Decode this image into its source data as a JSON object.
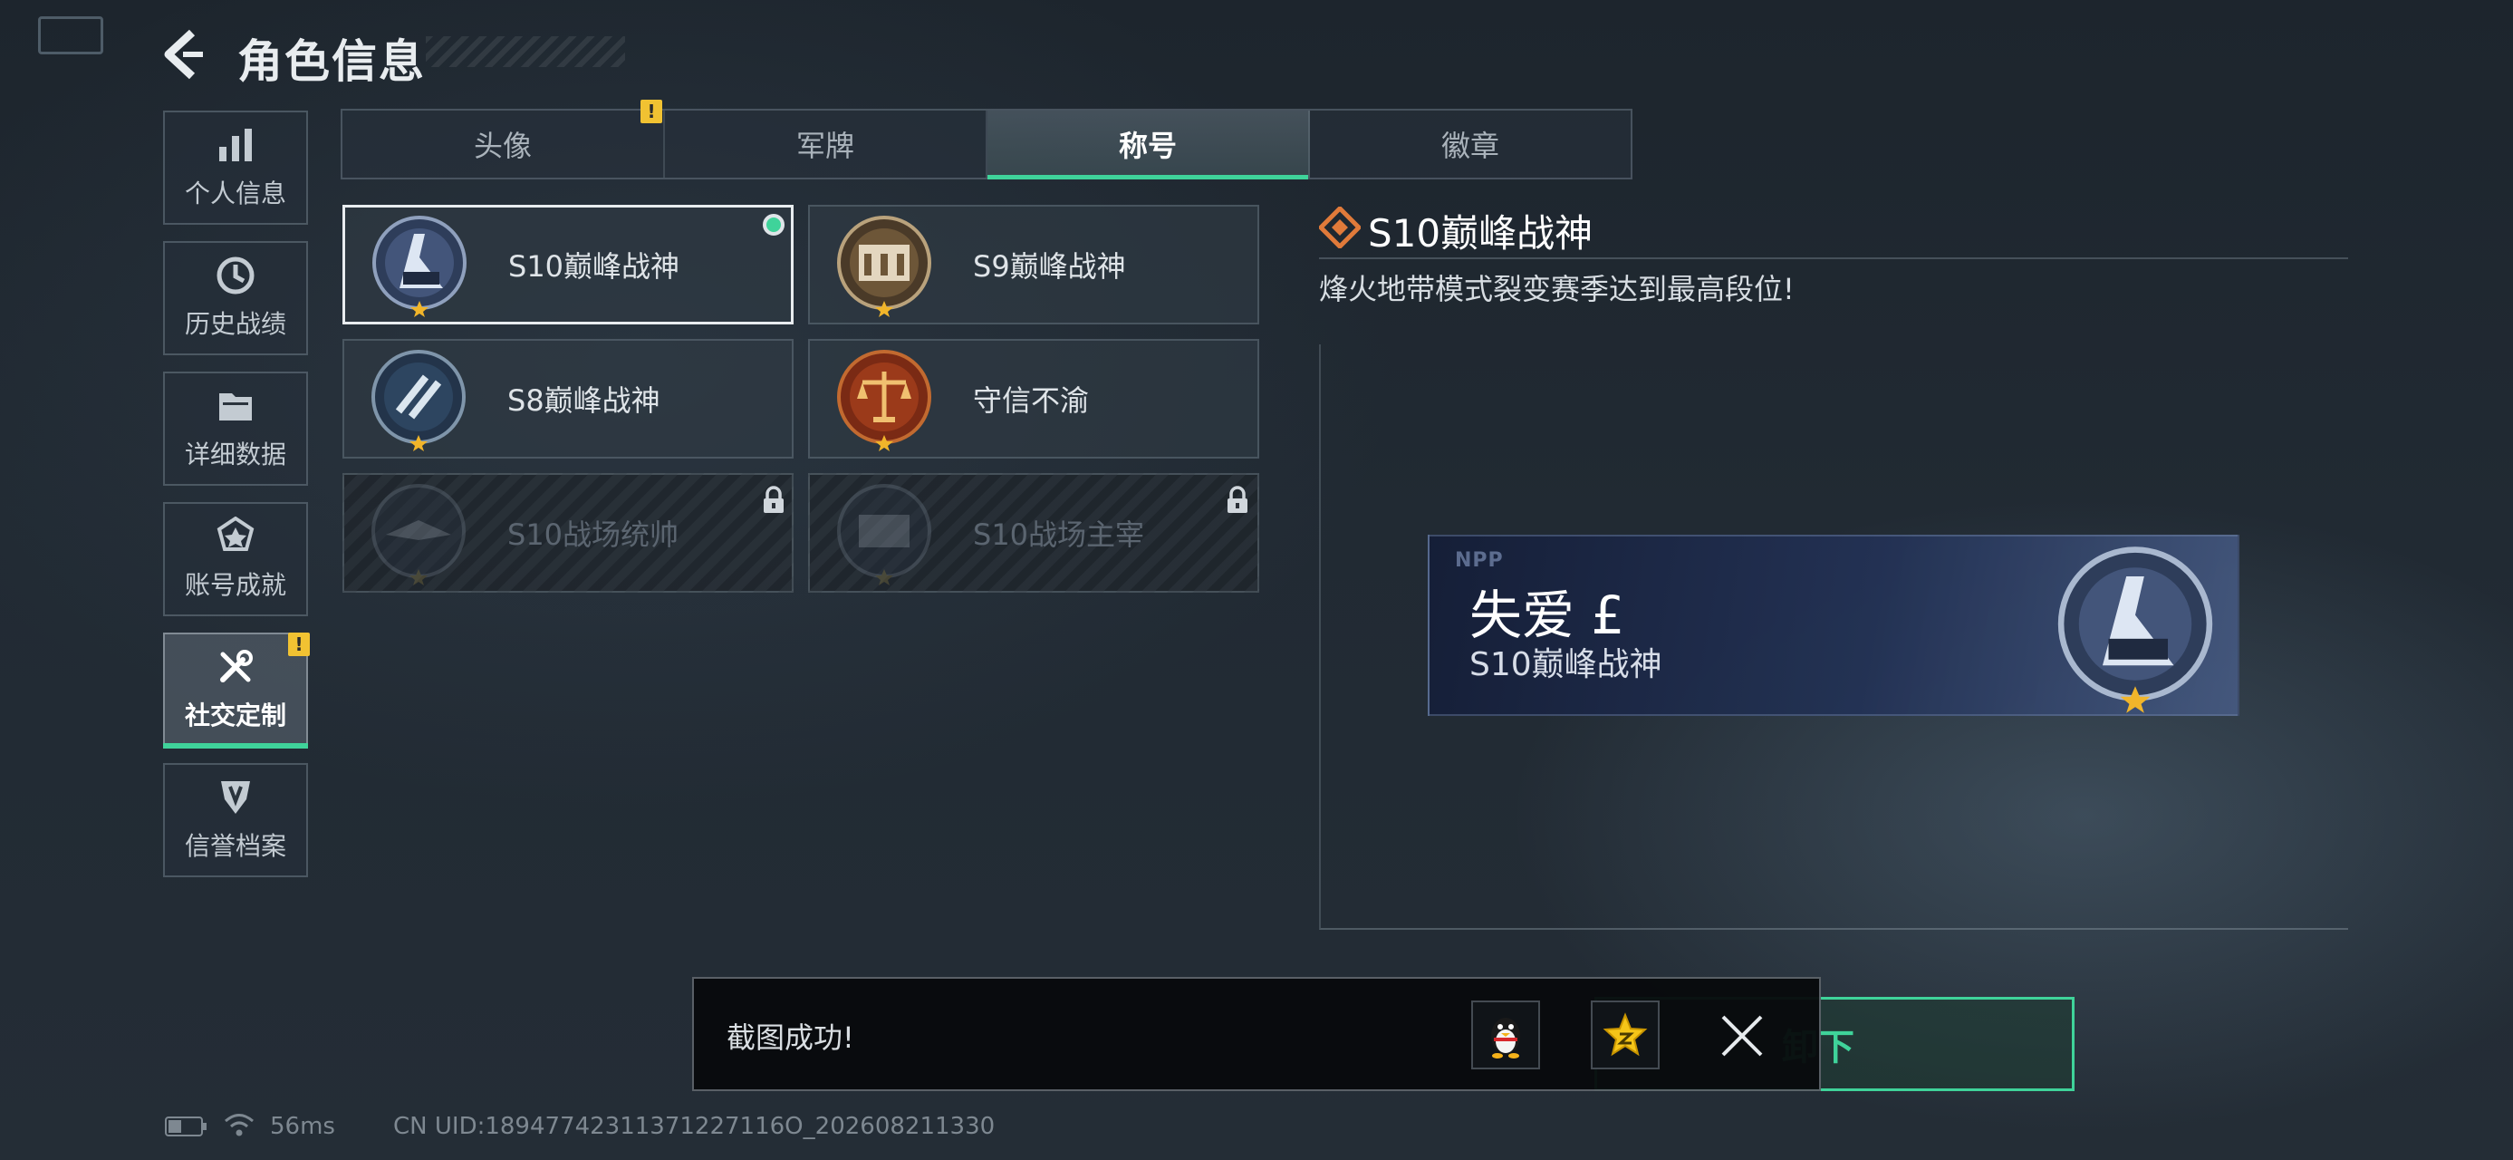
{
  "header": {
    "title": "角色信息"
  },
  "sidebar": {
    "items": [
      {
        "label": "个人信息",
        "icon": "bar-chart-icon"
      },
      {
        "label": "历史战绩",
        "icon": "clock-icon"
      },
      {
        "label": "详细数据",
        "icon": "folder-icon"
      },
      {
        "label": "账号成就",
        "icon": "medal-icon"
      },
      {
        "label": "社交定制",
        "icon": "tools-icon",
        "active": true,
        "badge": "!"
      },
      {
        "label": "信誉档案",
        "icon": "shield-icon"
      }
    ]
  },
  "tabs": [
    {
      "label": "头像",
      "badge": "!"
    },
    {
      "label": "军牌"
    },
    {
      "label": "称号",
      "active": true
    },
    {
      "label": "徽章"
    }
  ],
  "titles": [
    {
      "name": "S10巅峰战神",
      "selected": true,
      "equipped": true
    },
    {
      "name": "S9巅峰战神"
    },
    {
      "name": "S8巅峰战神"
    },
    {
      "name": "守信不渝"
    },
    {
      "name": "S10战场统帅",
      "locked": true
    },
    {
      "name": "S10战场主宰",
      "locked": true
    }
  ],
  "detail": {
    "title": "S10巅峰战神",
    "description": "烽火地带模式裂变赛季达到最高段位!"
  },
  "nameplate": {
    "tag": "NPP",
    "player_name": "失爱 £",
    "title": "S10巅峰战神"
  },
  "unequip_button": {
    "label_visible_part": "卸下"
  },
  "toast": {
    "message": "截图成功!"
  },
  "status_bar": {
    "ping": "56ms",
    "uid": "CN UID:18947742311371227116O_202608211330"
  },
  "colors": {
    "accent": "#3fd39a",
    "warning": "#f1c232",
    "detail_icon": "#e07a3a"
  }
}
